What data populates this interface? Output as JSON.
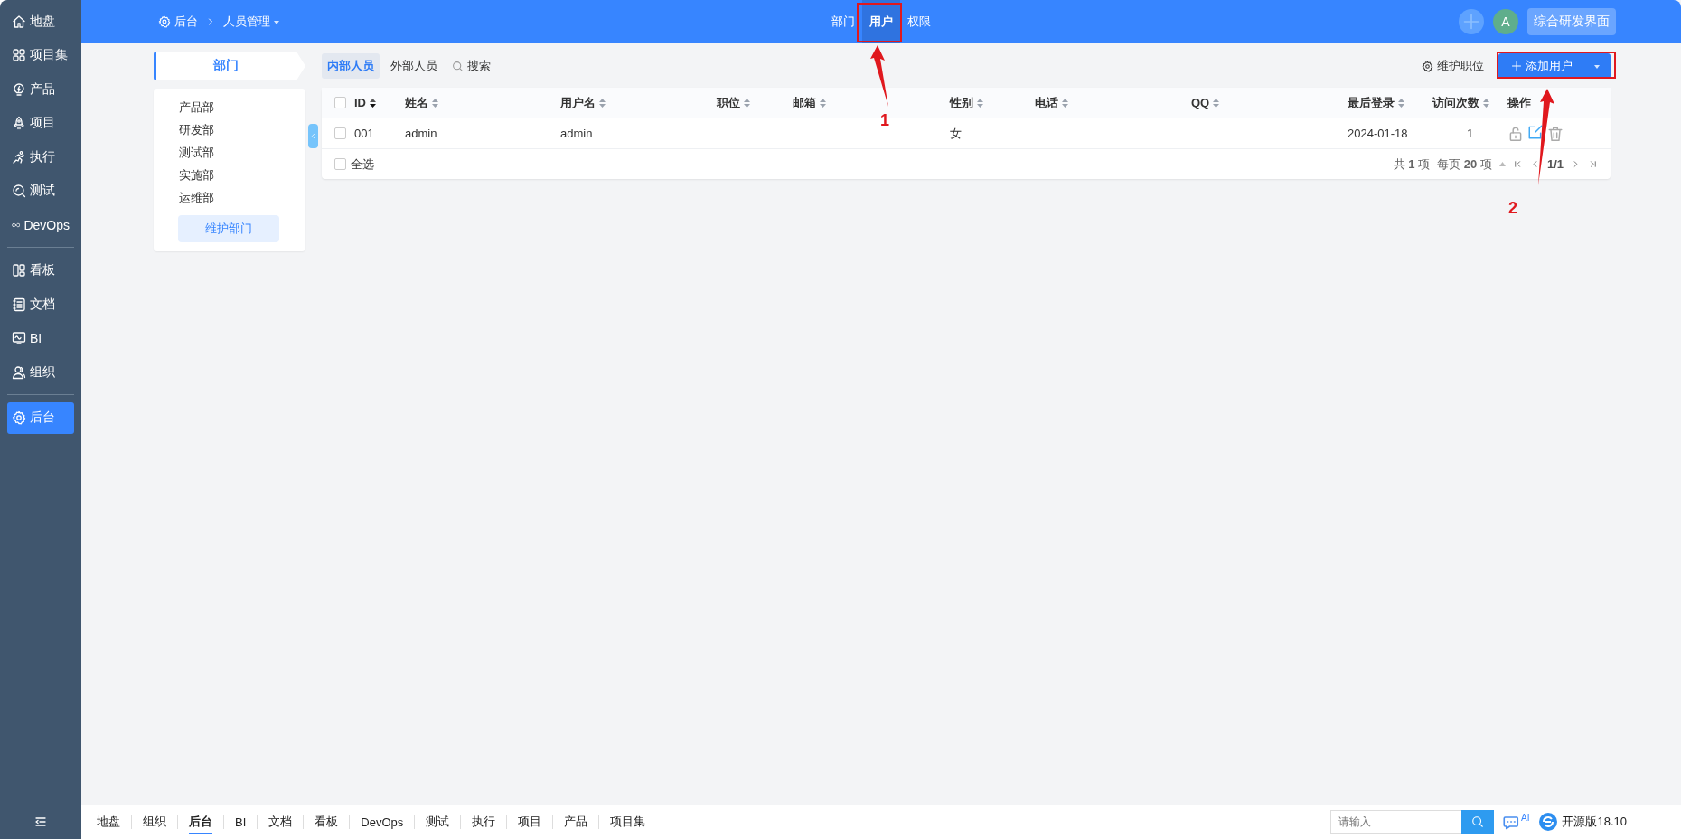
{
  "sidebar": {
    "groups": [
      [
        {
          "label": "地盘",
          "selected": false
        },
        {
          "label": "项目集",
          "selected": false
        },
        {
          "label": "产品",
          "selected": false
        },
        {
          "label": "项目",
          "selected": false
        },
        {
          "label": "执行",
          "selected": false
        },
        {
          "label": "测试",
          "selected": false
        },
        {
          "label": "DevOps",
          "selected": false
        }
      ],
      [
        {
          "label": "看板",
          "selected": false
        },
        {
          "label": "文档",
          "selected": false
        },
        {
          "label": "BI",
          "selected": false
        },
        {
          "label": "组织",
          "selected": false
        }
      ],
      [
        {
          "label": "后台",
          "selected": true
        }
      ]
    ]
  },
  "top_bar": {
    "breadcrumb": [
      {
        "label": "后台"
      },
      {
        "label": "人员管理"
      }
    ],
    "nav_tabs": [
      {
        "label": "部门",
        "selected": false
      },
      {
        "label": "用户",
        "selected": true
      },
      {
        "label": "权限",
        "selected": false
      }
    ],
    "avatar": "A",
    "workspace_button": "综合研发界面"
  },
  "dept_panel": {
    "title": "部门",
    "items": [
      "产品部",
      "研发部",
      "测试部",
      "实施部",
      "运维部"
    ],
    "button": "维护部门"
  },
  "toolbar": {
    "tabs": [
      {
        "label": "内部人员",
        "selected": true
      },
      {
        "label": "外部人员",
        "selected": false
      }
    ],
    "search": "搜索",
    "maintain_positions": "维护职位",
    "add_button": "添加用户"
  },
  "table": {
    "header_checked": false,
    "columns": [
      {
        "label": "ID",
        "sorted": true
      },
      {
        "label": "姓名",
        "sorted": false
      },
      {
        "label": "用户名",
        "sorted": false
      },
      {
        "label": "职位",
        "sorted": false
      },
      {
        "label": "邮箱",
        "sorted": false
      },
      {
        "label": "性别",
        "sorted": false
      },
      {
        "label": "电话",
        "sorted": false
      },
      {
        "label": "QQ",
        "sorted": false
      },
      {
        "label": "最后登录",
        "sorted": false
      },
      {
        "label": "访问次数",
        "sorted": false
      },
      {
        "label": "操作"
      }
    ],
    "rows": [
      {
        "checked": false,
        "id": "001",
        "name": "admin",
        "username": "admin",
        "gender": "女",
        "last_login": "2024-01-18",
        "visits": "1"
      }
    ],
    "footer": {
      "select_all": "全选",
      "checked": false,
      "total": "共 **1** 项",
      "page_size": "每页 **20** 项",
      "page": "1/1"
    }
  },
  "bottom_bar": {
    "tabs": [
      {
        "label": "地盘",
        "selected": false
      },
      {
        "label": "组织",
        "selected": false
      },
      {
        "label": "后台",
        "selected": true
      },
      {
        "label": "BI",
        "selected": false
      },
      {
        "label": "文档",
        "selected": false
      },
      {
        "label": "看板",
        "selected": false
      },
      {
        "label": "DevOps",
        "selected": false
      },
      {
        "label": "测试",
        "selected": false
      },
      {
        "label": "执行",
        "selected": false
      },
      {
        "label": "项目",
        "selected": false
      },
      {
        "label": "产品",
        "selected": false
      },
      {
        "label": "项目集",
        "selected": false
      }
    ],
    "search_placeholder": "请输入",
    "ai": "AI",
    "version": "开源版18.10"
  },
  "annotations": [
    {
      "label": "1"
    },
    {
      "label": "2"
    }
  ]
}
